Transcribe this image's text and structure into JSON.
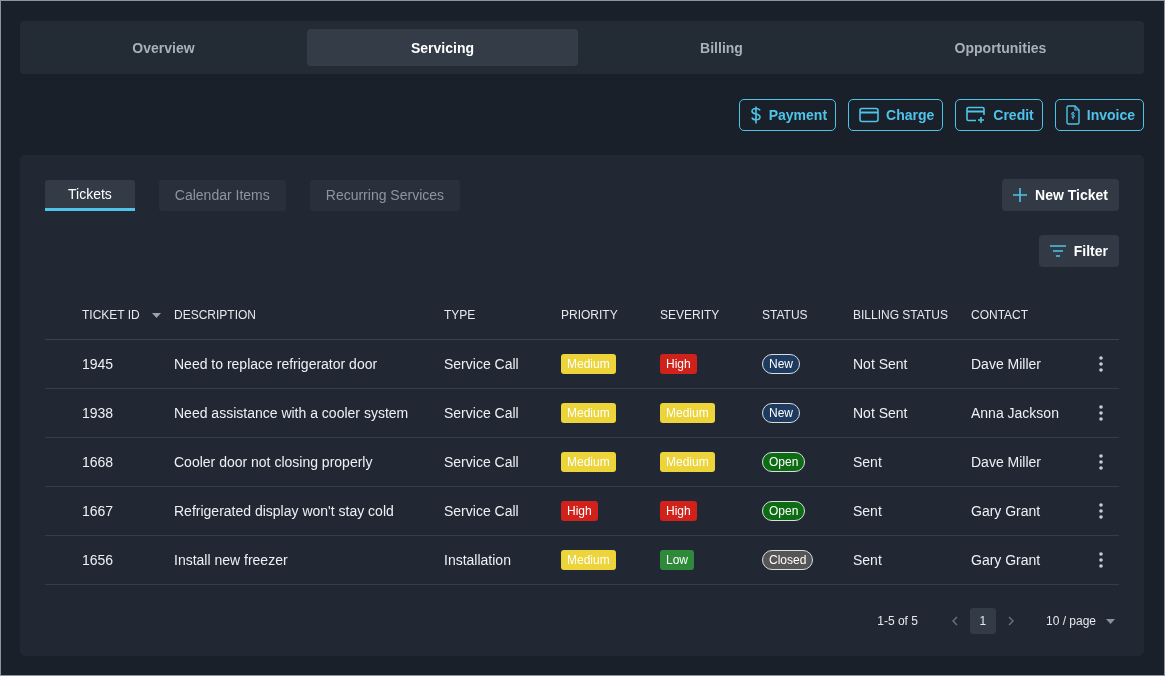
{
  "top_tabs": [
    {
      "label": "Overview",
      "selected": false
    },
    {
      "label": "Servicing",
      "selected": true
    },
    {
      "label": "Billing",
      "selected": false
    },
    {
      "label": "Opportunities",
      "selected": false
    }
  ],
  "actions": [
    {
      "kind": "dollar",
      "label": "Payment"
    },
    {
      "kind": "card",
      "label": "Charge"
    },
    {
      "kind": "card-plus",
      "label": "Credit"
    },
    {
      "kind": "document",
      "label": "Invoice"
    }
  ],
  "sub_tabs": [
    {
      "label": "Tickets",
      "selected": true
    },
    {
      "label": "Calendar Items",
      "selected": false
    },
    {
      "label": "Recurring Services",
      "selected": false
    }
  ],
  "new_ticket_button": "New Ticket",
  "filter_button": "Filter",
  "table": {
    "columns": [
      "TICKET ID",
      "DESCRIPTION",
      "TYPE",
      "PRIORITY",
      "SEVERITY",
      "STATUS",
      "BILLING STATUS",
      "CONTACT"
    ],
    "rows": [
      {
        "id": "1945",
        "description": "Need to replace refrigerator door",
        "type": "Service Call",
        "priority": {
          "text": "Medium",
          "color": "#ecd43a"
        },
        "severity": {
          "text": "High",
          "color": "#d0211a"
        },
        "status": {
          "text": "New",
          "color": "#1e3a5f"
        },
        "billing_status": "Not Sent",
        "contact": "Dave Miller"
      },
      {
        "id": "1938",
        "description": "Need assistance with a cooler system",
        "type": "Service Call",
        "priority": {
          "text": "Medium",
          "color": "#ecd43a"
        },
        "severity": {
          "text": "Medium",
          "color": "#ecd43a"
        },
        "status": {
          "text": "New",
          "color": "#1e3a5f"
        },
        "billing_status": "Not Sent",
        "contact": "Anna Jackson"
      },
      {
        "id": "1668",
        "description": "Cooler door not closing properly",
        "type": "Service Call",
        "priority": {
          "text": "Medium",
          "color": "#ecd43a"
        },
        "severity": {
          "text": "Medium",
          "color": "#ecd43a"
        },
        "status": {
          "text": "Open",
          "color": "#0d6b14"
        },
        "billing_status": "Sent",
        "contact": "Dave Miller"
      },
      {
        "id": "1667",
        "description": "Refrigerated display won't stay cold",
        "type": "Service Call",
        "priority": {
          "text": "High",
          "color": "#d0211a"
        },
        "severity": {
          "text": "High",
          "color": "#d0211a"
        },
        "status": {
          "text": "Open",
          "color": "#0d6b14"
        },
        "billing_status": "Sent",
        "contact": "Gary Grant"
      },
      {
        "id": "1656",
        "description": "Install new freezer",
        "type": "Installation",
        "priority": {
          "text": "Medium",
          "color": "#ecd43a"
        },
        "severity": {
          "text": "Low",
          "color": "#2e8a3a"
        },
        "status": {
          "text": "Closed",
          "color": "#555555"
        },
        "billing_status": "Sent",
        "contact": "Gary Grant"
      }
    ]
  },
  "pagination": {
    "range": "1-5 of 5",
    "pages": [
      {
        "label": "1",
        "selected": true
      }
    ],
    "page_size": "10 / page"
  }
}
